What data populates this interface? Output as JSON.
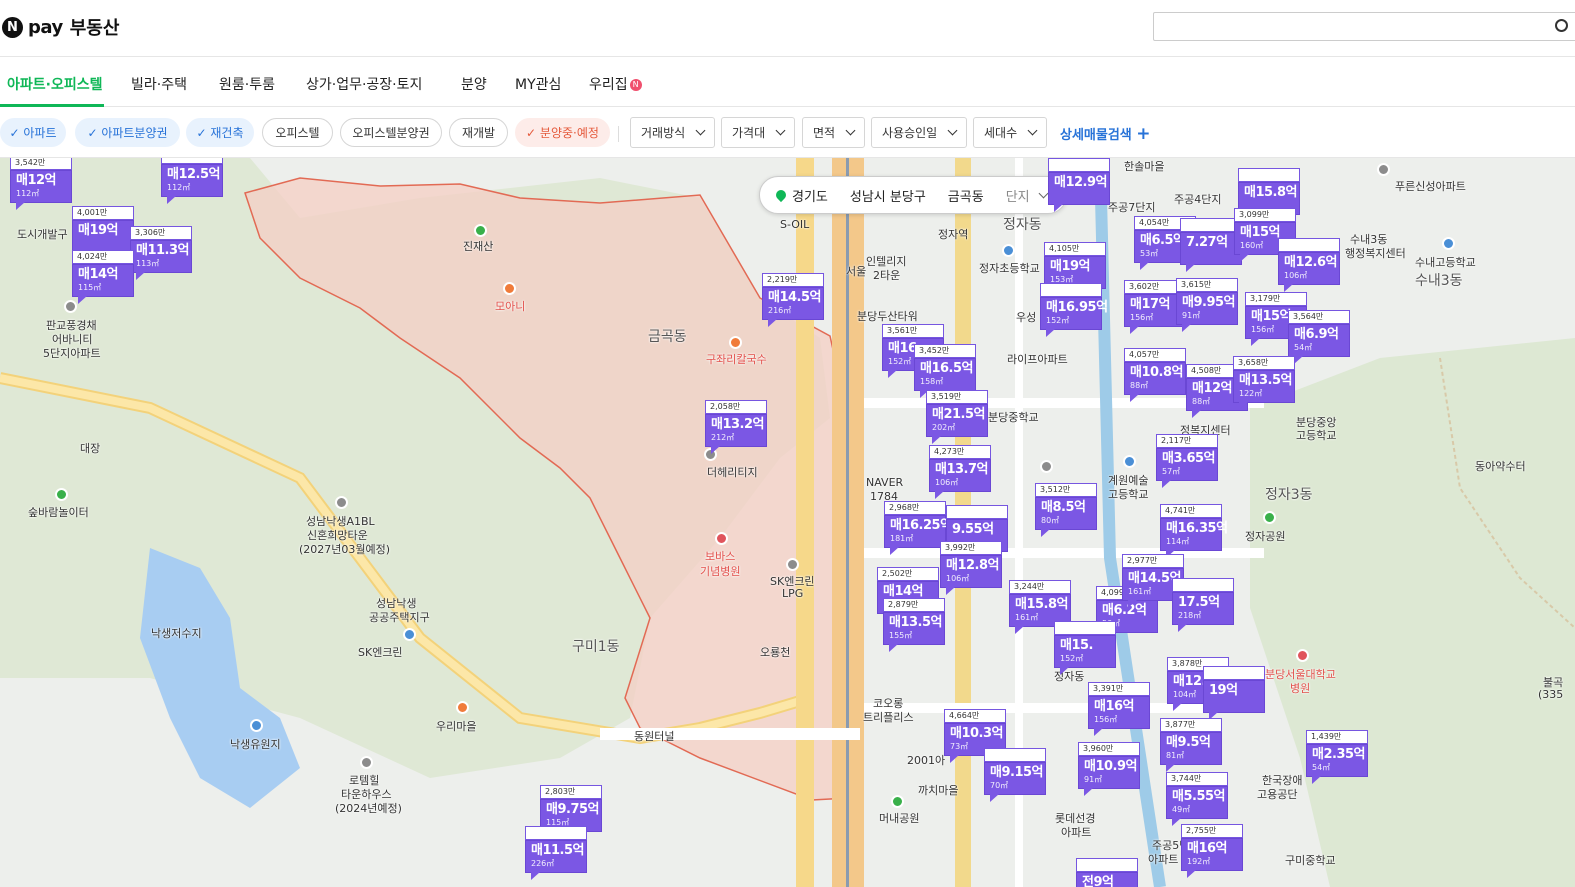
{
  "header": {
    "logo_n": "N",
    "logo_pay": "pay",
    "logo_title": "부동산",
    "search_placeholder": ""
  },
  "nav": {
    "tabs": [
      {
        "label": "아파트·오피스텔",
        "active": true
      },
      {
        "label": "빌라·주택"
      },
      {
        "label": "원룸·투룸"
      },
      {
        "label": "상가·업무·공장·토지"
      },
      {
        "label": "분양"
      },
      {
        "label": "MY관심"
      },
      {
        "label": "우리집",
        "badge": "N"
      }
    ]
  },
  "filters": {
    "chips": [
      {
        "label": "아파트",
        "state": "on"
      },
      {
        "label": "아파트분양권",
        "state": "on"
      },
      {
        "label": "재건축",
        "state": "on"
      },
      {
        "label": "오피스텔",
        "state": "off"
      },
      {
        "label": "오피스텔분양권",
        "state": "off"
      },
      {
        "label": "재개발",
        "state": "off"
      },
      {
        "label": "분양중·예정",
        "state": "sale"
      }
    ],
    "dropdowns": [
      "거래방식",
      "가격대",
      "면적",
      "사용승인일",
      "세대수"
    ],
    "advanced": "상세매물검색"
  },
  "breadcrumb": {
    "province": "경기도",
    "city": "성남시 분당구",
    "dong": "금곡동",
    "type": "단지"
  },
  "map_labels": [
    {
      "text": "진재산"
    },
    {
      "text": "모아니"
    },
    {
      "text": "금곡동"
    },
    {
      "text": "구좌리칼국수"
    },
    {
      "text": "더헤리티지"
    },
    {
      "text": "보바스"
    },
    {
      "text": "기념병원"
    },
    {
      "text": "SK엔크린"
    },
    {
      "text": "LPG"
    },
    {
      "text": "구미1동"
    },
    {
      "text": "오룡천"
    },
    {
      "text": "동원터널"
    },
    {
      "text": "우리마을"
    },
    {
      "text": "성남낙생A1BL"
    },
    {
      "text": "신혼희망타운"
    },
    {
      "text": "(2027년03월예정)"
    },
    {
      "text": "성남낙생"
    },
    {
      "text": "공공주택지구"
    },
    {
      "text": "SK엔크린"
    },
    {
      "text": "낙생저수지"
    },
    {
      "text": "숲바람놀이터"
    },
    {
      "text": "대장"
    },
    {
      "text": "낙생유원지"
    },
    {
      "text": "로템힐"
    },
    {
      "text": "타운하우스"
    },
    {
      "text": "(2024년예정)"
    },
    {
      "text": "판교풍경채"
    },
    {
      "text": "어바니티"
    },
    {
      "text": "5단지아파트"
    },
    {
      "text": "도시개발구"
    },
    {
      "text": "S-OIL"
    },
    {
      "text": "서울"
    },
    {
      "text": "인텔리지"
    },
    {
      "text": "2타운"
    },
    {
      "text": "분당두산타워"
    },
    {
      "text": "정자역"
    },
    {
      "text": "정자동"
    },
    {
      "text": "정자초등학교"
    },
    {
      "text": "NAVER"
    },
    {
      "text": "1784"
    },
    {
      "text": "라이프아파트"
    },
    {
      "text": "우성"
    },
    {
      "text": "분당중학교"
    },
    {
      "text": "코오롱"
    },
    {
      "text": "트리플리스"
    },
    {
      "text": "2001아"
    },
    {
      "text": "까치마을"
    },
    {
      "text": "머내공원"
    },
    {
      "text": "롯데선경"
    },
    {
      "text": "아파트"
    },
    {
      "text": "계원예술"
    },
    {
      "text": "고등학교"
    },
    {
      "text": "정자3동"
    },
    {
      "text": "정자공원"
    },
    {
      "text": "분당서울대학교"
    },
    {
      "text": "병원"
    },
    {
      "text": "한국장애"
    },
    {
      "text": "고용공단"
    },
    {
      "text": "구미중학교"
    },
    {
      "text": "푸른신성아파트"
    },
    {
      "text": "수내고등학교"
    },
    {
      "text": "수내3동"
    },
    {
      "text": "수내3동"
    },
    {
      "text": "행정복지센터"
    },
    {
      "text": "동아약수터"
    },
    {
      "text": "분당중앙"
    },
    {
      "text": "고등학교"
    },
    {
      "text": "정복지센터"
    },
    {
      "text": "주공4단지"
    },
    {
      "text": "주공7단지"
    },
    {
      "text": "한솔마을"
    },
    {
      "text": "정자동"
    },
    {
      "text": "주공5단"
    },
    {
      "text": "아파트"
    },
    {
      "text": "(335"
    },
    {
      "text": "불곡"
    }
  ],
  "markers": [
    {
      "count": "3,542만",
      "price": "매12억",
      "area": "112㎡"
    },
    {
      "count": "",
      "price": "매12.5억",
      "area": "112㎡"
    },
    {
      "count": "4,001만",
      "price": "매19억",
      "area": ""
    },
    {
      "count": "3,306만",
      "price": "매11.3억",
      "area": "113㎡"
    },
    {
      "count": "4,024만",
      "price": "매14억",
      "area": "115㎡"
    },
    {
      "count": "2,219만",
      "price": "매14.5억",
      "area": "216㎡"
    },
    {
      "count": "2,058만",
      "price": "매13.2억",
      "area": "212㎡"
    },
    {
      "count": "3,561만",
      "price": "매16",
      "area": "152㎡"
    },
    {
      "count": "3,452만",
      "price": "매16.5억",
      "area": "158㎡"
    },
    {
      "count": "3,519만",
      "price": "매21.5억",
      "area": "202㎡"
    },
    {
      "count": "4,273만",
      "price": "매13.7억",
      "area": "106㎡"
    },
    {
      "count": "2,968만",
      "price": "매16.25억",
      "area": "181㎡"
    },
    {
      "count": "",
      "price": "9.55억",
      "area": ""
    },
    {
      "count": "3,992만",
      "price": "매12.8억",
      "area": "106㎡"
    },
    {
      "count": "2,502만",
      "price": "매14억",
      "area": ""
    },
    {
      "count": "2,879만",
      "price": "매13.5억",
      "area": "155㎡"
    },
    {
      "count": "3,244만",
      "price": "매15.8억",
      "area": "161㎡"
    },
    {
      "count": "4,099",
      "price": "매6.2억",
      "area": "50㎡"
    },
    {
      "count": "",
      "price": "매15.",
      "area": "152㎡"
    },
    {
      "count": "4,664만",
      "price": "매10.3억",
      "area": "73㎡"
    },
    {
      "count": "",
      "price": "매9.15억",
      "area": "70㎡"
    },
    {
      "count": "3,512만",
      "price": "매8.5억",
      "area": "80㎡"
    },
    {
      "count": "2,117만",
      "price": "매3.65억",
      "area": "57㎡"
    },
    {
      "count": "4,741만",
      "price": "매16.35억",
      "area": "114㎡"
    },
    {
      "count": "2,977만",
      "price": "매14.5억",
      "area": "161㎡"
    },
    {
      "count": "",
      "price": "17.5억",
      "area": "218㎡"
    },
    {
      "count": "3,391만",
      "price": "매16억",
      "area": "156㎡"
    },
    {
      "count": "3,960만",
      "price": "매10.9억",
      "area": "91㎡"
    },
    {
      "count": "3,878만",
      "price": "매12.2억",
      "area": "104㎡"
    },
    {
      "count": "",
      "price": "19억",
      "area": ""
    },
    {
      "count": "3,877만",
      "price": "매9.5억",
      "area": "81㎡"
    },
    {
      "count": "3,744만",
      "price": "매5.55억",
      "area": "49㎡"
    },
    {
      "count": "2,755만",
      "price": "매16억",
      "area": "192㎡"
    },
    {
      "count": "1,439만",
      "price": "매2.35억",
      "area": "54㎡"
    },
    {
      "count": "",
      "price": "매12.9억",
      "area": ""
    },
    {
      "count": "4,105만",
      "price": "매19억",
      "area": "153㎡"
    },
    {
      "count": "",
      "price": "매16.95억",
      "area": "152㎡"
    },
    {
      "count": "4,054만",
      "price": "매6.5억",
      "area": "53㎡"
    },
    {
      "count": "",
      "price": "7.27억",
      "area": ""
    },
    {
      "count": "3,602만",
      "price": "매17억",
      "area": "156㎡"
    },
    {
      "count": "3,615만",
      "price": "매9.95억",
      "area": "91㎡"
    },
    {
      "count": "4,057만",
      "price": "매10.8억",
      "area": "88㎡"
    },
    {
      "count": "4,508만",
      "price": "매12억",
      "area": "88㎡"
    },
    {
      "count": "",
      "price": "매15.8억",
      "area": ""
    },
    {
      "count": "3,099만",
      "price": "매15억",
      "area": "160㎡"
    },
    {
      "count": "",
      "price": "매12.6억",
      "area": "106㎡"
    },
    {
      "count": "3,179만",
      "price": "매15억",
      "area": "156㎡"
    },
    {
      "count": "3,564만",
      "price": "매6.9억",
      "area": "54㎡"
    },
    {
      "count": "3,658만",
      "price": "매13.5억",
      "area": "122㎡"
    },
    {
      "count": "2,803만",
      "price": "매9.75억",
      "area": "115㎡"
    },
    {
      "count": "",
      "price": "매11.5억",
      "area": "226㎡"
    },
    {
      "count": "",
      "price": "전9억",
      "area": ""
    }
  ]
}
